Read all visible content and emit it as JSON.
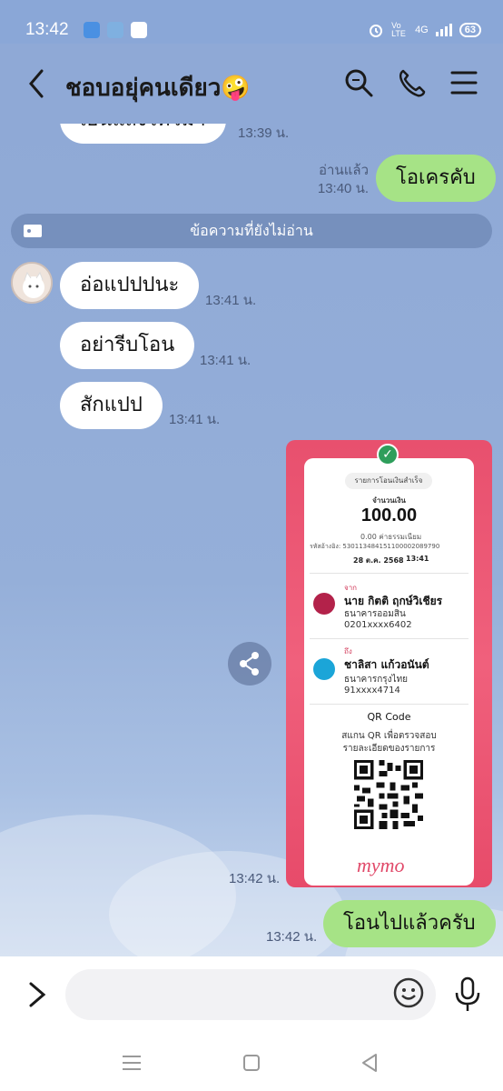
{
  "status_bar": {
    "time": "13:42",
    "network": "4G",
    "volte": "Vo LTE",
    "battery": "63"
  },
  "header": {
    "chat_name": "ชอบอยุ่คนเดียว🤪"
  },
  "messages": {
    "m0_text": "เยนแสงไทวมา",
    "m0_time": "13:39 น.",
    "m1_text": "โอเครคับ",
    "m1_read": "อ่านแล้ว",
    "m1_time": "13:40 น.",
    "unread_divider": "ข้อความที่ยังไม่อ่าน",
    "m2_text": "อ่อแปปปนะ",
    "m2_time": "13:41 น.",
    "m3_text": "อย่ารีบโอน",
    "m3_time": "13:41 น.",
    "m4_text": "สักแปป",
    "m4_time": "13:41 น.",
    "m5_time": "13:42 น.",
    "m6_text": "โอนไปแล้วครับ",
    "m6_time": "13:42 น."
  },
  "receipt": {
    "status": "รายการโอนเงินสำเร็จ",
    "amount_label": "จำนวนเงิน",
    "amount": "100.00",
    "fee": "0.00 ค่าธรรมเนียม",
    "ref": "รหัสอ้างอิง: 530113484151100002089790",
    "date": "28 ต.ค. 2568",
    "time": "13:41",
    "from_label": "จาก",
    "from_name": "นาย กิตติ ฤกษ์วิเชียร",
    "from_bank": "ธนาคารออมสิน",
    "from_account": "0201xxxx6402",
    "to_label": "ถึง",
    "to_name": "ชาลิสา แก้วอนันต์",
    "to_bank": "ธนาคารกรุงไทย",
    "to_account": "91xxxx4714",
    "qr_title": "QR Code",
    "qr_desc1": "สแกน QR เพื่อตรวจสอบ",
    "qr_desc2": "รายละเอียดของรายการ",
    "brand": "mymo"
  },
  "input": {
    "placeholder": ""
  },
  "colors": {
    "chat_bg": "#8fa9d6",
    "my_bubble": "#a6e386",
    "receipt_pink": "#e8506e"
  }
}
